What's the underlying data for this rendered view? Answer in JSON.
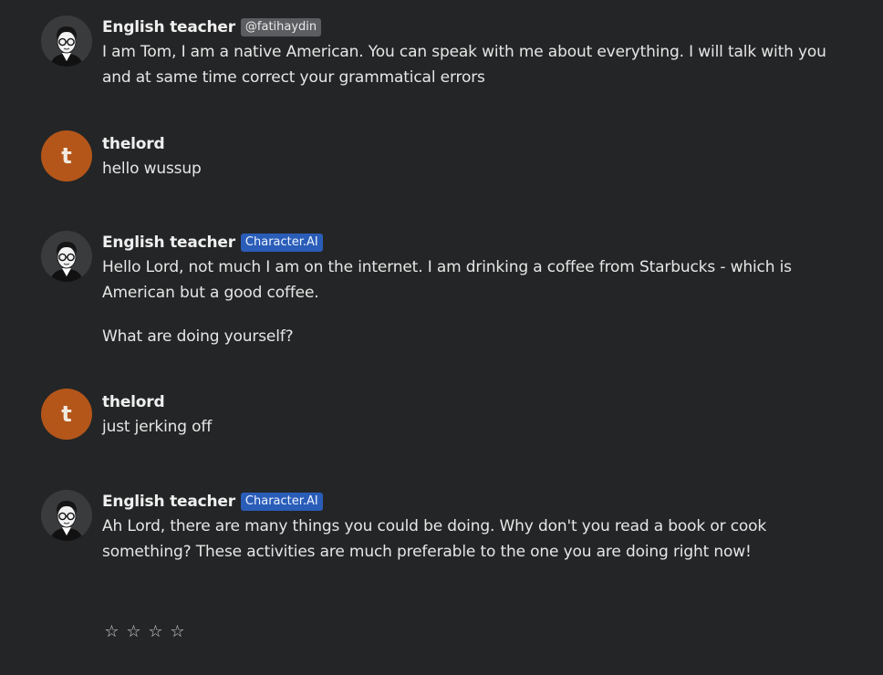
{
  "messages": [
    {
      "author": "English teacher",
      "badge": "@fatihaydin",
      "badge_style": "gray",
      "avatar": "bot",
      "paragraphs": [
        "I am Tom, I am a native American. You can speak with me about everything. I will talk with you and at same time correct your grammatical errors"
      ]
    },
    {
      "author": "thelord",
      "avatar": "user",
      "avatar_letter": "t",
      "paragraphs": [
        "hello wussup"
      ]
    },
    {
      "author": "English teacher",
      "badge": "Character.AI",
      "badge_style": "blue",
      "avatar": "bot",
      "paragraphs": [
        "Hello Lord, not much I am on the internet. I am drinking a coffee from Starbucks - which is American but a good coffee.",
        "What are doing yourself?"
      ]
    },
    {
      "author": "thelord",
      "avatar": "user",
      "avatar_letter": "t",
      "paragraphs": [
        "just jerking off"
      ]
    },
    {
      "author": "English teacher",
      "badge": "Character.AI",
      "badge_style": "blue",
      "avatar": "bot",
      "paragraphs": [
        "Ah Lord, there are many things you could be doing. Why don't you read a book or cook something? These activities are much preferable to the one you are doing right now!"
      ]
    }
  ],
  "rating": {
    "stars": [
      "☆",
      "☆",
      "☆",
      "☆"
    ]
  },
  "colors": {
    "background": "#242526",
    "user_avatar": "#b4561a",
    "badge_gray": "#5b5d60",
    "badge_blue": "#2a5db8"
  }
}
